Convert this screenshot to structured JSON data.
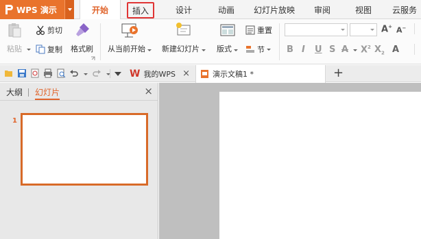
{
  "app": {
    "name": "WPS 演示"
  },
  "tabs": [
    {
      "label": "开始",
      "active": true
    },
    {
      "label": "插入",
      "highlighted": true
    },
    {
      "label": "设计"
    },
    {
      "label": "动画"
    },
    {
      "label": "幻灯片放映"
    },
    {
      "label": "审阅"
    },
    {
      "label": "视图"
    },
    {
      "label": "云服务"
    }
  ],
  "ribbon": {
    "paste": "粘贴",
    "cut": "剪切",
    "copy": "复制",
    "format_painter": "格式刷",
    "from_current": "从当前开始",
    "new_slide": "新建幻灯片",
    "layout": "版式",
    "reset": "重置",
    "section": "节"
  },
  "doc_tabs": [
    {
      "label": "我的WPS"
    },
    {
      "label": "演示文稿1 *"
    }
  ],
  "panel": {
    "outline_tab": "大纲",
    "slides_tab": "幻灯片",
    "slide_number": "1"
  },
  "colors": {
    "accent": "#e9732c",
    "highlight_border": "#e03434",
    "thumb_border": "#d86a28"
  }
}
